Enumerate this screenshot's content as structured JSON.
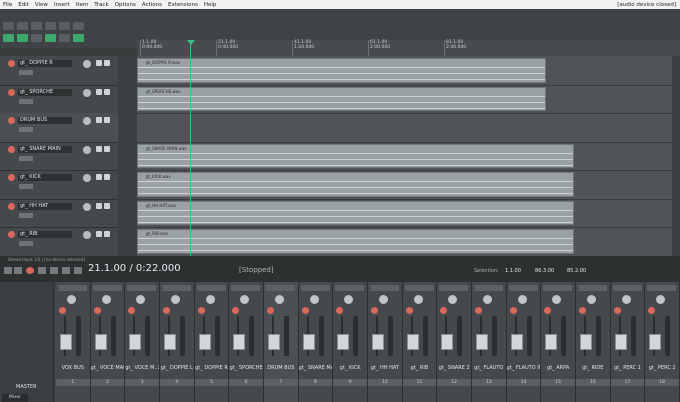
{
  "menubar": {
    "items": [
      "File",
      "Edit",
      "View",
      "Insert",
      "Item",
      "Track",
      "Options",
      "Actions",
      "Extensions",
      "Help"
    ],
    "status": "[audio device closed]"
  },
  "ruler": {
    "marks": [
      {
        "bar": "1.1.00",
        "time": "0:00.000"
      },
      {
        "bar": "21.1.00",
        "time": "0:40.000"
      },
      {
        "bar": "41.1.00",
        "time": "1:20.000"
      },
      {
        "bar": "61.1.00",
        "time": "2:00.000"
      },
      {
        "bar": "81.1.00",
        "time": "2:40.000"
      }
    ]
  },
  "tracks": [
    {
      "name": "gt_ DOPPIE R",
      "item": "gt_DOPPIE R.wav",
      "folder": false
    },
    {
      "name": "gt_ SPORCHE",
      "item": "gt_SPORCHE.wav",
      "folder": false
    },
    {
      "name": "DRUM BUS",
      "item": "",
      "folder": true
    },
    {
      "name": "gt_ SNARE MAIN",
      "item": "gt_SNARE MAIN.wav",
      "folder": false
    },
    {
      "name": "gt_ KICK",
      "item": "gt_KICK.wav",
      "folder": false
    },
    {
      "name": "gt_ HH HAT",
      "item": "gt_HH HAT.wav",
      "folder": false
    },
    {
      "name": "gt_ RIB",
      "item": "gt_RIB.wav",
      "folder": false
    }
  ],
  "transport": {
    "info": "Stereo Input 1/2 / [no device selected]",
    "timecode": "21.1.00 / 0:22.000",
    "state": "[Stopped]",
    "selection_label": "Selection:",
    "selection_start": "1.1.00",
    "selection_end": "86.3.00",
    "selection_length": "85.2.00"
  },
  "mixer": {
    "master_label": "MASTER",
    "master_tab": "Mixer",
    "channels": [
      {
        "name": "VOX BUS",
        "num": "1"
      },
      {
        "name": "gt_ VOCE MAI",
        "num": "2"
      },
      {
        "name": "gt_ VOCE M..2",
        "num": "3"
      },
      {
        "name": "gt_ DOPPIE L",
        "num": "4"
      },
      {
        "name": "gt_ DOPPIE R",
        "num": "5"
      },
      {
        "name": "gt_ SPORCHE",
        "num": "6"
      },
      {
        "name": "DRUM BUS",
        "num": "7"
      },
      {
        "name": "gt_ SNARE MA",
        "num": "8"
      },
      {
        "name": "gt_ KICK",
        "num": "9"
      },
      {
        "name": "gt_ HH HAT",
        "num": "10"
      },
      {
        "name": "gt_ RIB",
        "num": "11"
      },
      {
        "name": "gt_ SNARE 2",
        "num": "12"
      },
      {
        "name": "gt_ FLAUTO",
        "num": "13"
      },
      {
        "name": "gt_ FLAUTO IN",
        "num": "14"
      },
      {
        "name": "gt_ ARPA",
        "num": "15"
      },
      {
        "name": "gt_ RIDE",
        "num": "16"
      },
      {
        "name": "gt_ PERC 1",
        "num": "17"
      },
      {
        "name": "gt_ PERC 2",
        "num": "18"
      }
    ]
  },
  "colors": {
    "accent": "#35c283",
    "record": "#d9685c"
  }
}
